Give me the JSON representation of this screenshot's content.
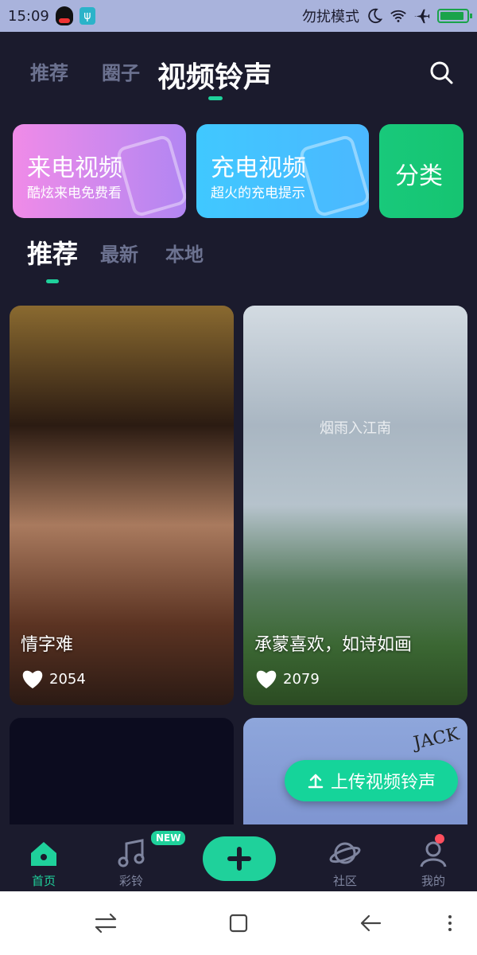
{
  "status_bar": {
    "time": "15:09",
    "mode_text": "勿扰模式",
    "usb_symbol": "ψ"
  },
  "top_tabs": {
    "items": [
      {
        "label": "推荐"
      },
      {
        "label": "圈子"
      },
      {
        "label": "视频铃声"
      }
    ],
    "active_index": 2
  },
  "banners": [
    {
      "title": "来电视频",
      "subtitle": "酷炫来电免费看"
    },
    {
      "title": "充电视频",
      "subtitle": "超火的充电提示"
    },
    {
      "title": "分类",
      "subtitle": ""
    }
  ],
  "sub_tabs": {
    "items": [
      {
        "label": "推荐"
      },
      {
        "label": "最新"
      },
      {
        "label": "本地"
      }
    ],
    "active_index": 0
  },
  "cards": [
    {
      "title": "情字难",
      "likes": "2054"
    },
    {
      "title": "承蒙喜欢，如诗如画",
      "likes": "2079",
      "overlay_text": "烟雨入江南"
    },
    {
      "title": "",
      "likes": ""
    },
    {
      "title": "",
      "likes": "",
      "logo_text": "JACK"
    }
  ],
  "upload_button": {
    "label": "上传视频铃声"
  },
  "bottom_nav": {
    "items": [
      {
        "label": "首页"
      },
      {
        "label": "彩铃"
      },
      {
        "label": "社区"
      },
      {
        "label": "我的"
      }
    ],
    "new_badge": "NEW",
    "active_index": 0
  },
  "colors": {
    "accent": "#1fd19b",
    "background": "#1b1b2d",
    "status_bar": "#a9b3dc"
  }
}
